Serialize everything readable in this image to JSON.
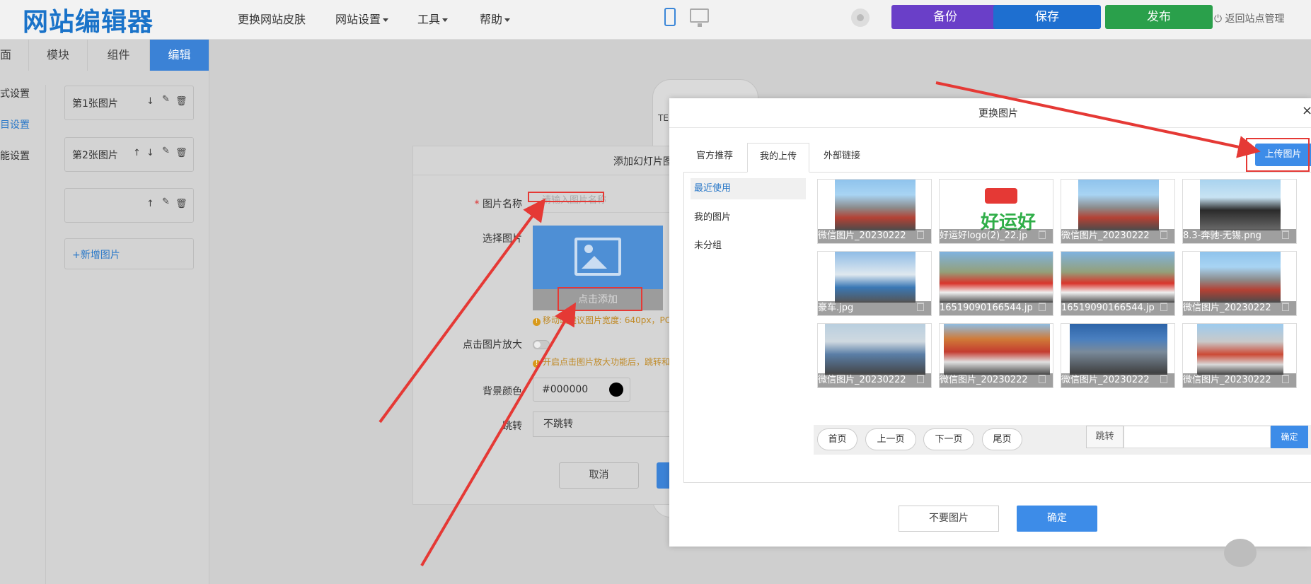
{
  "topbar": {
    "logo": "网站编辑器",
    "menu": [
      {
        "label": "更换网站皮肤",
        "caret": false
      },
      {
        "label": "网站设置",
        "caret": true
      },
      {
        "label": "工具",
        "caret": true
      },
      {
        "label": "帮助",
        "caret": true
      }
    ],
    "backup": "备份",
    "save": "保存",
    "publish": "发布",
    "logout": "返回站点管理",
    "colors": {
      "backup": "#6a3fc8",
      "save": "#1e6fd0",
      "publish": "#2aa04b"
    }
  },
  "left": {
    "tabs": [
      "面",
      "模块",
      "组件",
      "编辑"
    ],
    "sections": [
      "式设置",
      "目设置",
      "能设置"
    ],
    "slides": [
      "第1张图片",
      "第2张图片",
      ""
    ],
    "add_slide": "+新增图片"
  },
  "dialog1": {
    "title": "添加幻灯片图",
    "name_label": "图片名称",
    "name_required": "*",
    "name_placeholder": "请输入图片名称",
    "choose_label": "选择图片",
    "add_button": "点击添加",
    "size_hint": "移动端建议图片宽度: 640px，PC",
    "zoom_label": "点击图片放大",
    "zoom_hint": "开启点击图片放大功能后，跳转和",
    "bg_label": "背景颜色",
    "bg_value": "#000000",
    "jump_label": "跳转",
    "jump_value": "不跳转",
    "cancel": "取消"
  },
  "dialog2": {
    "title": "更换图片",
    "close": "×",
    "tabs": [
      "官方推荐",
      "我的上传",
      "外部链接"
    ],
    "upload": "上传图片",
    "categories": [
      "最近使用",
      "我的图片",
      "未分组"
    ],
    "images": [
      "微信图片_20230222",
      "好运好logo(2)_22.jp",
      "微信图片_20230222",
      "8.3-奔驰-无锡.png",
      "豪车.jpg",
      "16519090166544.jp",
      "16519090166544.jp",
      "微信图片_20230222",
      "微信图片_20230222",
      "微信图片_20230222",
      "微信图片_20230222",
      "微信图片_20230222"
    ],
    "pager": [
      "首页",
      "上一页",
      "下一页",
      "尾页"
    ],
    "jump": "跳转",
    "jump_ok": "确定",
    "no_image": "不要图片",
    "ok": "确定"
  },
  "phone_preview": {
    "label": "TE"
  },
  "annotation_color": "#e53935"
}
